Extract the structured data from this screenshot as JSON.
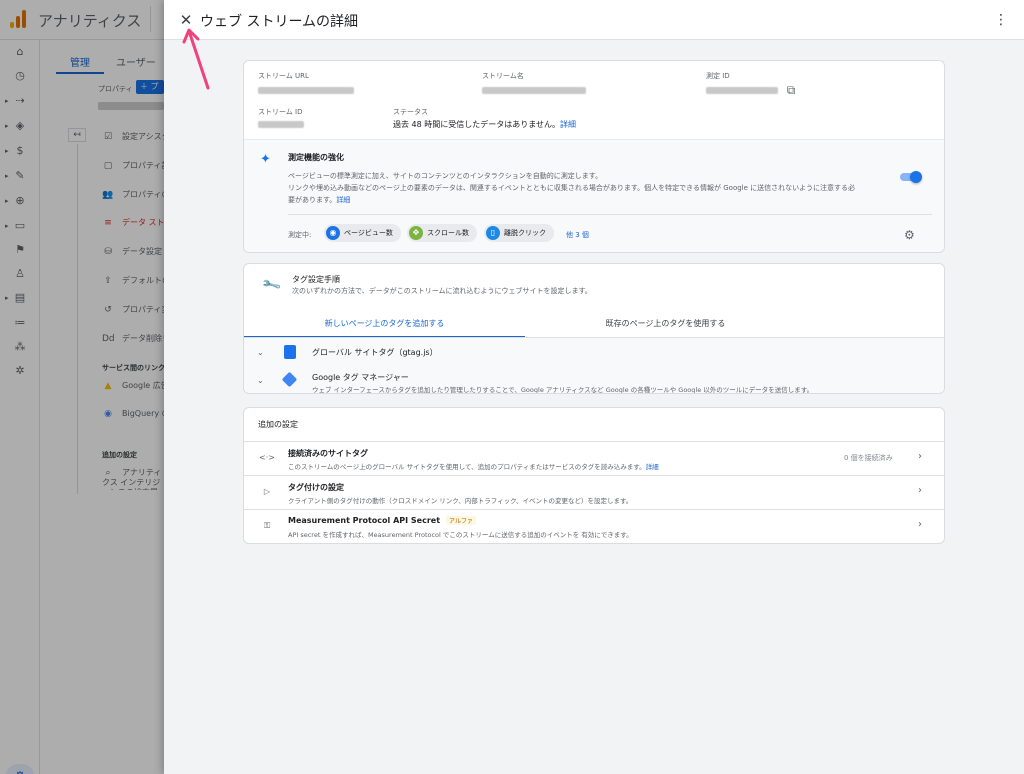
{
  "background": {
    "app_title": "アナリティクス",
    "tabs": [
      "管理",
      "ユーザー"
    ],
    "property_label": "プロパティ",
    "property_button": "＋ プロ",
    "menu_items": [
      {
        "icon": "☑",
        "label": "設定アシスタント"
      },
      {
        "icon": "▢",
        "label": "プロパティ設定"
      },
      {
        "icon": "👥",
        "label": "プロパティのアクセス管理"
      },
      {
        "icon": "≡",
        "label": "データ ストリーム",
        "active": true
      },
      {
        "icon": "⛁",
        "label": "データ設定"
      },
      {
        "icon": "⇪",
        "label": "デフォルトのレポート"
      },
      {
        "icon": "↺",
        "label": "プロパティ変更履歴"
      },
      {
        "icon": "Dd",
        "label": "データ削除リクエスト"
      }
    ],
    "section_links": "サービス間のリンク設定",
    "links": [
      {
        "icon": "▲",
        "label": "Google 広告とのリンク"
      },
      {
        "icon": "◉",
        "label": "BigQuery のリンク"
      }
    ],
    "section_extra": "追加の設定",
    "extra_item": "アナリティクス インテリジェンスの検索履歴"
  },
  "drawer": {
    "title": "ウェブ ストリームの詳細",
    "close_icon": "✕",
    "more_icon": "⋮"
  },
  "stream": {
    "url_label": "ストリーム URL",
    "name_label": "ストリーム名",
    "measurement_id_label": "測定 ID",
    "stream_id_label": "ストリーム ID",
    "status_label": "ステータス",
    "status_text": "過去 48 時間に受信したデータはありません。",
    "status_link": "詳細"
  },
  "enhanced": {
    "title": "測定機能の強化",
    "desc_line1": "ページビューの標準測定に加え、サイトのコンテンツとのインタラクションを自動的に測定します。",
    "desc_line2": "リンクや埋め込み動画などのページ上の要素のデータは、関連するイベントとともに収集される場合があります。個人を特定できる情報が Google に送信されないように注意する必",
    "desc_line3": "要があります。",
    "desc_link": "詳細",
    "enabled": true,
    "measuring_label": "測定中:",
    "chips": [
      {
        "label": "ページビュー数",
        "icon": "eye-icon",
        "glyph": "◉",
        "color": "#1a73e8"
      },
      {
        "label": "スクロール数",
        "icon": "scroll-icon",
        "glyph": "✥",
        "color": "#7cb342"
      },
      {
        "label": "離脱クリック",
        "icon": "mouse-icon",
        "glyph": "▯",
        "color": "#1e88e5"
      }
    ],
    "more_link": "他 3 個"
  },
  "tagging": {
    "title": "タグ設定手順",
    "subtitle": "次のいずれかの方法で、データがこのストリームに流れ込むようにウェブサイトを設定します。",
    "tabs": [
      "新しいページ上のタグを追加する",
      "既存のページ上のタグを使用する"
    ],
    "options": [
      {
        "name": "グローバル サイトタグ（gtag.js）",
        "desc": ""
      },
      {
        "name": "Google タグ マネージャー",
        "desc": "ウェブ インターフェースからタグを追加したり管理したりすることで、Google アナリティクスなど Google の各種ツールや Google 以外のツールにデータを送信します。"
      }
    ]
  },
  "additional": {
    "title": "追加の設定",
    "rows": [
      {
        "icon": "<·>",
        "title": "接続済みのサイトタグ",
        "desc": "このストリームのページ上のグローバル サイトタグを使用して、追加のプロパティまたはサービスのタグを読み込みます。",
        "link": "詳細",
        "right": "0 個を接続済み"
      },
      {
        "icon": "▷",
        "title": "タグ付けの設定",
        "desc": "クライアント側のタグ付けの動作（クロスドメイン リンク、内部トラフィック、イベントの変更など）を設定します。",
        "link": "",
        "right": ""
      },
      {
        "icon": "⚿",
        "title": "Measurement Protocol API Secret",
        "badge": "アルファ",
        "desc": "API secret を作成すれば、Measurement Protocol でこのストリームに送信する追加のイベントを 有効にできます。",
        "link": "",
        "right": ""
      }
    ]
  }
}
